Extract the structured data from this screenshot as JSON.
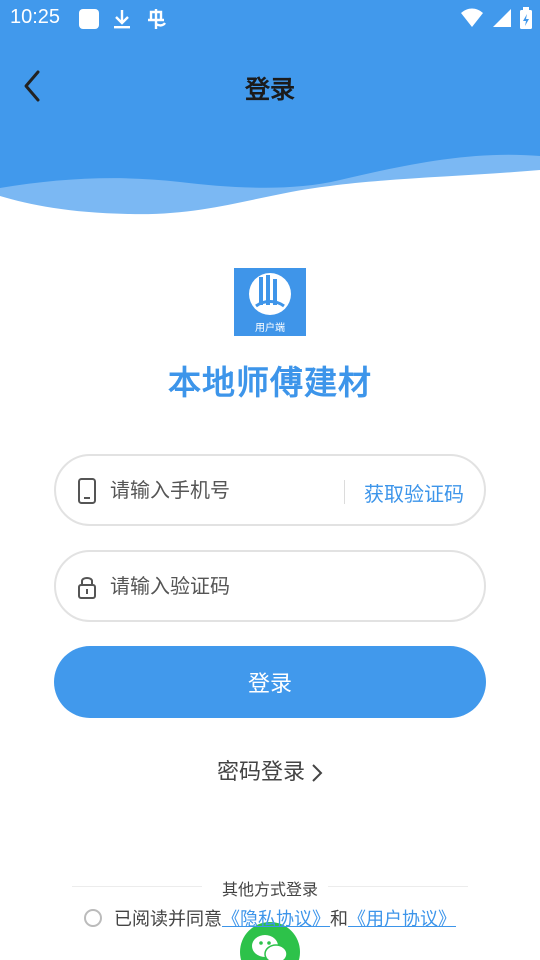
{
  "status_bar": {
    "time": "10:25",
    "left_icons": [
      "square-notification-icon",
      "download-icon",
      "bug-icon"
    ],
    "right_icons": [
      "wifi-icon",
      "signal-icon",
      "battery-icon"
    ]
  },
  "nav": {
    "back_icon": "chevron-left-icon",
    "title": "登录"
  },
  "logo": {
    "caption": "用户端"
  },
  "app_name": "本地师傅建材",
  "phone_field": {
    "placeholder": "请输入手机号",
    "value": "",
    "icon": "phone-icon",
    "get_code_label": "获取验证码"
  },
  "code_field": {
    "placeholder": "请输入验证码",
    "value": "",
    "icon": "lock-icon"
  },
  "login_button": "登录",
  "password_login": "密码登录",
  "other_methods": "其他方式登录",
  "agreement": {
    "prefix": "已阅读并同意",
    "privacy_link": "《隐私协议》",
    "and": "和",
    "user_link": "《用户协议》"
  },
  "colors": {
    "primary": "#3d95ea",
    "header_light": "#7bb8f3",
    "wechat": "#2dc24a"
  }
}
